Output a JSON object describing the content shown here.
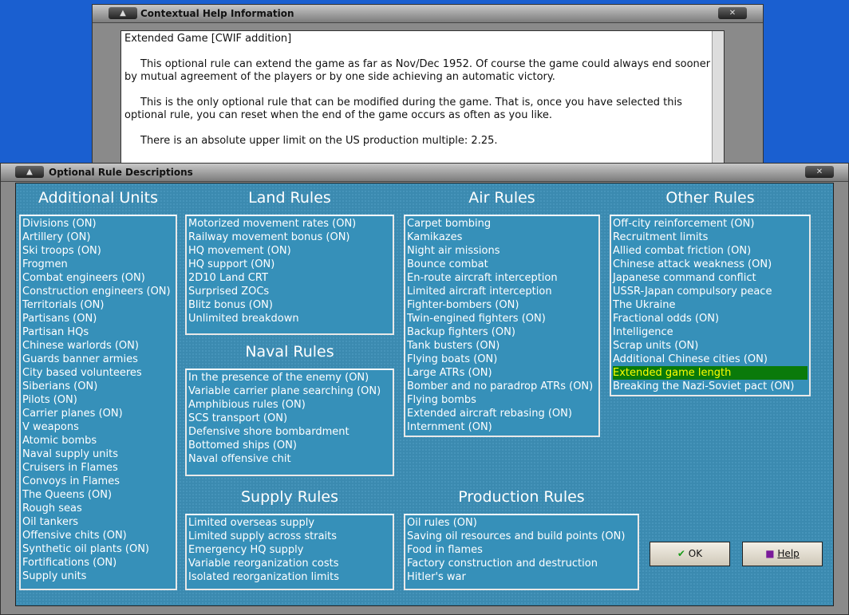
{
  "help_window": {
    "title": "Contextual Help Information",
    "paragraphs": [
      "Extended Game [CWIF addition]",
      "This optional rule can extend the game as far as Nov/Dec 1952.  Of course the game could always end sooner by mutual agreement of the players or by one side achieving an automatic victory.",
      "This is the only optional rule that can be modified during the game.  That is, once you have selected this optional rule, you can reset when the end of the game occurs as often as you like.",
      "There is an absolute upper limit on the US production multiple: 2.25."
    ]
  },
  "main_window": {
    "title": "Optional Rule Descriptions"
  },
  "sections": {
    "additional_units": {
      "title": "Additional Units",
      "items": [
        "Divisions (ON)",
        "Artillery (ON)",
        "Ski troops (ON)",
        "Frogmen",
        "Combat engineers (ON)",
        "Construction engineers (ON)",
        "Territorials (ON)",
        "Partisans (ON)",
        "Partisan HQs",
        "Chinese warlords (ON)",
        "Guards banner armies",
        "City based volunteeres",
        "Siberians (ON)",
        "Pilots (ON)",
        "Carrier planes (ON)",
        "V weapons",
        "Atomic bombs",
        "Naval supply units",
        "Cruisers in Flames",
        "Convoys in Flames",
        "The Queens (ON)",
        "Rough seas",
        "Oil tankers",
        "Offensive chits (ON)",
        "Synthetic oil plants (ON)",
        "Fortifications (ON)",
        "Supply units"
      ]
    },
    "land": {
      "title": "Land Rules",
      "items": [
        "Motorized movement rates (ON)",
        "Railway movement bonus (ON)",
        "HQ movement (ON)",
        "HQ support (ON)",
        "2D10 Land CRT",
        "Surprised ZOCs",
        "Blitz bonus (ON)",
        "Unlimited breakdown"
      ]
    },
    "naval": {
      "title": "Naval Rules",
      "items": [
        "In the presence of the enemy (ON)",
        "Variable carrier plane searching (ON)",
        "Amphibious rules (ON)",
        "SCS transport (ON)",
        "Defensive shore bombardment",
        "Bottomed ships (ON)",
        "Naval offensive chit"
      ]
    },
    "supply": {
      "title": "Supply Rules",
      "items": [
        "Limited overseas supply",
        "Limited supply across straits",
        "Emergency HQ supply",
        "Variable reorganization costs",
        "Isolated reorganization limits"
      ]
    },
    "air": {
      "title": "Air Rules",
      "items": [
        "Carpet bombing",
        "Kamikazes",
        "Night air missions",
        "Bounce combat",
        "En-route aircraft interception",
        "Limited aircraft interception",
        "Fighter-bombers (ON)",
        "Twin-engined fighters (ON)",
        "Backup fighters (ON)",
        "Tank busters (ON)",
        "Flying boats (ON)",
        "Large ATRs (ON)",
        "Bomber and no paradrop ATRs (ON)",
        "Flying bombs",
        "Extended aircraft rebasing (ON)",
        "Internment (ON)"
      ]
    },
    "production": {
      "title": "Production Rules",
      "items": [
        "Oil rules (ON)",
        "Saving oil resources and build points (ON)",
        "Food in flames",
        "Factory construction and destruction",
        "Hitler's war"
      ]
    },
    "other": {
      "title": "Other Rules",
      "selected": "Extended game length",
      "items": [
        "Off-city reinforcement (ON)",
        "Recruitment limits",
        "Allied combat friction (ON)",
        "Chinese attack weakness (ON)",
        "Japanese command conflict",
        "USSR-Japan compulsory peace",
        "The Ukraine",
        "Fractional odds (ON)",
        "Intelligence",
        "Scrap units (ON)",
        "Additional Chinese cities (ON)",
        "Extended game length",
        "Breaking the Nazi-Soviet pact (ON)"
      ]
    }
  },
  "buttons": {
    "ok": "OK",
    "help": "Help"
  }
}
